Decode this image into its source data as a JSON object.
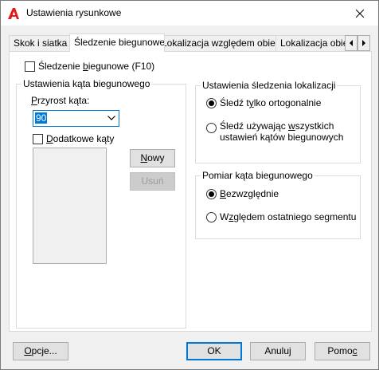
{
  "window": {
    "title": "Ustawienia rysunkowe"
  },
  "tabs": [
    {
      "label": "Skok i siatka"
    },
    {
      "label": "Śledzenie biegunowe"
    },
    {
      "label": "Lokalizacja względem obiektu"
    },
    {
      "label": "Lokalizacja obiek"
    }
  ],
  "polar": {
    "enable_pre": "Śledzenie ",
    "enable_u": "b",
    "enable_post": "iegunowe (F10)",
    "enable_checked": false
  },
  "angles": {
    "title": "Ustawienia kąta biegunowego",
    "increment_u": "P",
    "increment_rest": "rzyrost kąta:",
    "increment_value": "90",
    "additional_u": "D",
    "additional_rest": "odatkowe kąty",
    "new_u": "N",
    "new_rest": "owy",
    "delete_label": "Usuń"
  },
  "tracking": {
    "title": "Ustawienia śledzenia lokalizacji",
    "ortho_pre": "Śledź t",
    "ortho_u": "y",
    "ortho_post": "lko ortogonalnie",
    "all_pre": "Śledź używając ",
    "all_u": "w",
    "all_post": "szystkich",
    "all_line2": "ustawień kątów biegunowych",
    "selected": "ortho"
  },
  "measure": {
    "title": "Pomiar kąta biegunowego",
    "absolute_u": "B",
    "absolute_rest": "ezwzględnie",
    "relative_pre": "W",
    "relative_u": "z",
    "relative_post": "ględem ostatniego segmentu",
    "selected": "absolute"
  },
  "footer": {
    "options_u": "O",
    "options_rest": "pcje...",
    "ok": "OK",
    "cancel": "Anuluj",
    "help_pre": "Pomo",
    "help_u": "c"
  }
}
